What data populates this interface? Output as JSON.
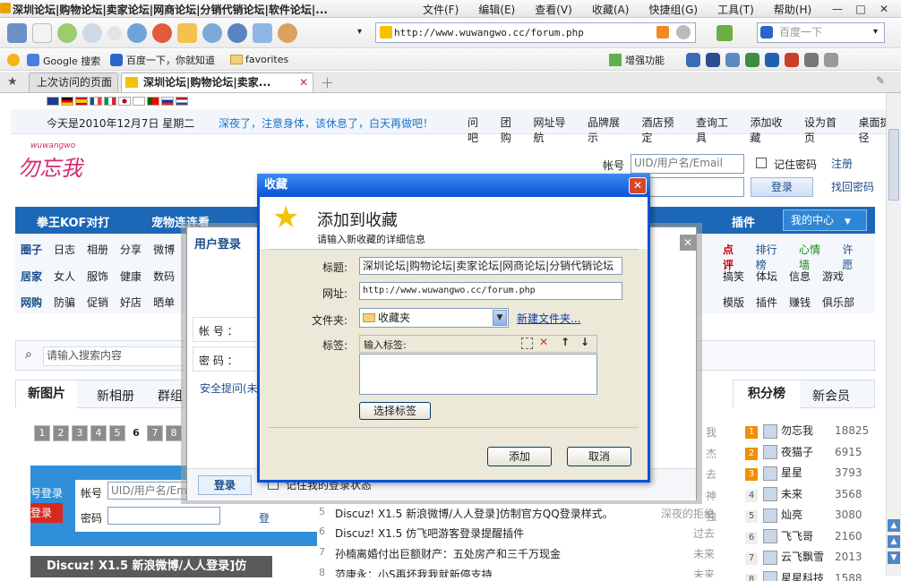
{
  "window": {
    "title": "深圳论坛|购物论坛|卖家论坛|网商论坛|分销代销论坛|软件论坛|...",
    "menu": [
      "文件(F)",
      "编辑(E)",
      "查看(V)",
      "收藏(A)",
      "快捷组(G)",
      "工具(T)",
      "帮助(H)"
    ],
    "controls": [
      "—",
      "□",
      "✕"
    ]
  },
  "toolbar": {
    "address": "http://www.wuwangwo.cc/forum.php",
    "search_placeholder": "百度一下"
  },
  "links_bar": {
    "items": [
      "Google 搜索",
      "百度一下，你就知道",
      "favorites"
    ],
    "enhance": "增强功能"
  },
  "tabs": [
    {
      "label": "上次访问的页面"
    },
    {
      "label": "深圳论坛|购物论坛|卖家..."
    }
  ],
  "page": {
    "date": "今天是2010年12月7日 星期二",
    "notice": "深夜了，注意身体，该休息了，白天再做吧！",
    "top_links": [
      "问吧",
      "团购",
      "网址导航",
      "品牌展示",
      "酒店预定",
      "查询工具",
      "添加收藏",
      "设为首页",
      "桌面捷径"
    ],
    "logo_text": "勿忘我",
    "logo_sub": "wuwangwo",
    "account_label": "帐号",
    "account_placeholder": "UID/用户名/Email",
    "remember": "记住密码",
    "register": "注册",
    "login_btn": "登录",
    "forgot": "找回密码",
    "nav": [
      "拳王KOF对打",
      "宠物连连看",
      "插件",
      "我的中心"
    ],
    "subrow1": [
      "圈子",
      "日志",
      "相册",
      "分享",
      "微博"
    ],
    "subrow1_right": [
      "点评",
      "排行榜",
      "心情墙",
      "许愿"
    ],
    "subrow2": [
      "居家",
      "女人",
      "服饰",
      "健康",
      "数码"
    ],
    "subrow2_right": [
      "搞笑",
      "体坛",
      "信息",
      "游戏"
    ],
    "subrow3": [
      "网购",
      "防骗",
      "促销",
      "好店",
      "晒单"
    ],
    "subrow3_right": [
      "模版",
      "插件",
      "赚钱",
      "俱乐部"
    ],
    "search_placeholder": "请输入搜索内容",
    "tabs_left": [
      "新图片",
      "新相册",
      "群组"
    ],
    "pager": [
      "1",
      "2",
      "3",
      "4",
      "5",
      "6",
      "7",
      "8"
    ],
    "tabs_right": [
      "积分榜",
      "新会员"
    ],
    "ranking": [
      {
        "n": "1",
        "name": "勿忘我",
        "score": "18825"
      },
      {
        "n": "2",
        "name": "夜猫子",
        "score": "6915"
      },
      {
        "n": "3",
        "name": "星星",
        "score": "3793"
      },
      {
        "n": "4",
        "name": "未来",
        "score": "3568"
      },
      {
        "n": "5",
        "name": "灿亮",
        "score": "3080"
      },
      {
        "n": "6",
        "name": "飞飞哥",
        "score": "2160"
      },
      {
        "n": "7",
        "name": "云飞飘雪",
        "score": "2013"
      },
      {
        "n": "8",
        "name": "星星科技",
        "score": "1588"
      }
    ],
    "posts": [
      {
        "n": "5",
        "title": "Discuz! X1.5 新浪微博/人人登录]仿制官方QQ登录样式。",
        "author": "深夜的拒绝"
      },
      {
        "n": "6",
        "title": "Discuz! X1.5 仿飞吧游客登录提醒插件",
        "author": "过去"
      },
      {
        "n": "7",
        "title": "孙楠离婚付出巨额财产：五处房产和三千万现金",
        "author": "未来"
      },
      {
        "n": "8",
        "title": "范康永：小S再坏我我就新停支持",
        "author": "未来"
      }
    ],
    "right_authors": [
      "我",
      "杰",
      "去",
      "神",
      "独"
    ],
    "banner": "Discuz! X1.5 新浪微博/人人登录]仿",
    "mini_login_title": "号登录",
    "mini_login_sub": "登录",
    "mini_account": "帐号",
    "mini_password": "密码",
    "mini_placeholder": "UID/用户名/Em",
    "mini_btn": "登"
  },
  "login_popup": {
    "title": "用户登录",
    "account_label": "帐 号 ：",
    "password_label": "密 码 ：",
    "security": "安全提问(未",
    "login_btn": "登录",
    "remember": "记住我的登录状态"
  },
  "dialog": {
    "title": "收藏",
    "heading": "添加到收藏",
    "subheading": "请输入新收藏的详细信息",
    "title_label": "标题:",
    "title_value": "深圳论坛|购物论坛|卖家论坛|网商论坛|分销代销论坛",
    "url_label": "网址:",
    "url_value": "http://www.wuwangwo.cc/forum.php",
    "folder_label": "文件夹:",
    "folder_value": "收藏夹",
    "new_folder": "新建文件夹...",
    "tag_label": "标签:",
    "tag_input_hint": "输入标签:",
    "choose_tag": "选择标签",
    "add": "添加",
    "cancel": "取消"
  }
}
